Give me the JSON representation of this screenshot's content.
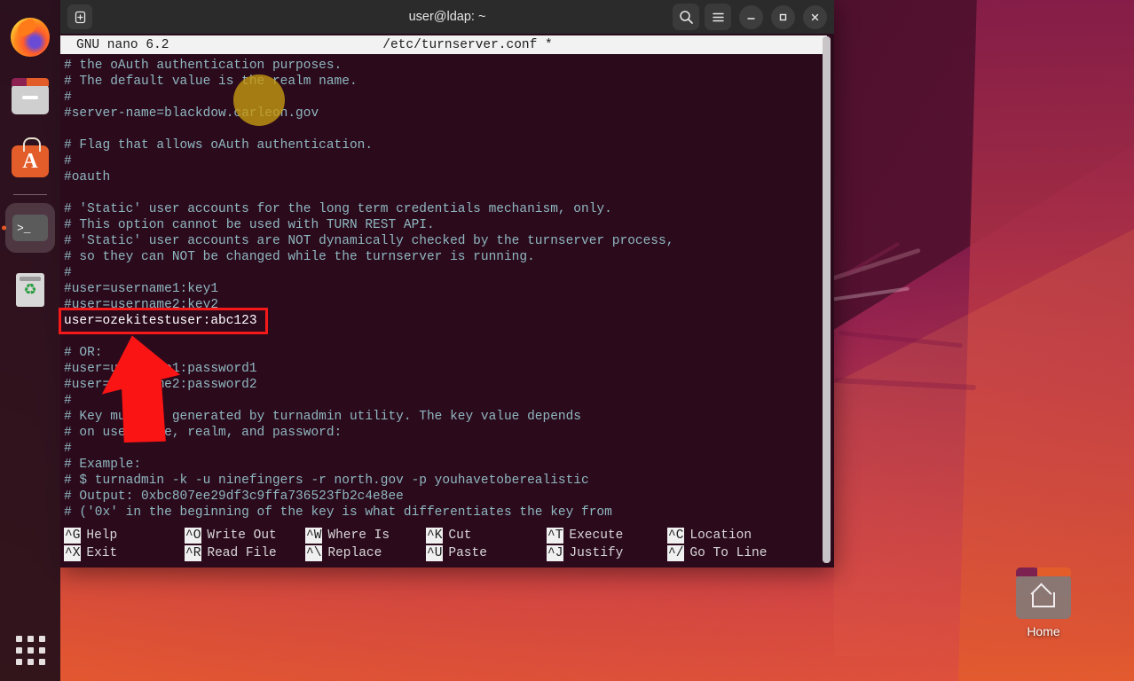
{
  "desktop": {
    "home_icon_label": "Home",
    "wallpaper_colors": [
      "#5d1236",
      "#912050",
      "#b92f52",
      "#e2572f"
    ]
  },
  "dock": {
    "items": [
      {
        "name": "firefox",
        "label": "Firefox",
        "active": false
      },
      {
        "name": "files",
        "label": "Files",
        "active": false
      },
      {
        "name": "ubuntu-software",
        "label": "Ubuntu Software",
        "letter": "A",
        "active": false
      },
      {
        "name": "terminal",
        "label": "Terminal",
        "glyph": ">_",
        "active": true
      },
      {
        "name": "trash",
        "label": "Trash",
        "glyph": "♻",
        "active": false
      }
    ],
    "show_apps_label": "Show Applications"
  },
  "window": {
    "title": "user@ldap: ~",
    "buttons": {
      "new_tab": "+",
      "search": "search-icon",
      "menu": "hamburger-menu-icon",
      "minimize": "–",
      "maximize": "□",
      "close": "✕"
    }
  },
  "editor": {
    "version": "GNU nano 6.2",
    "filename": "/etc/turnserver.conf *",
    "lines": [
      {
        "text": "# the oAuth authentication purposes.",
        "highlight": false
      },
      {
        "text": "# The default value is the realm name.",
        "highlight": false
      },
      {
        "text": "#",
        "highlight": false
      },
      {
        "text": "#server-name=blackdow.carleon.gov",
        "highlight": false
      },
      {
        "text": "",
        "highlight": false
      },
      {
        "text": "# Flag that allows oAuth authentication.",
        "highlight": false
      },
      {
        "text": "#",
        "highlight": false
      },
      {
        "text": "#oauth",
        "highlight": false
      },
      {
        "text": "",
        "highlight": false
      },
      {
        "text": "# 'Static' user accounts for the long term credentials mechanism, only.",
        "highlight": false
      },
      {
        "text": "# This option cannot be used with TURN REST API.",
        "highlight": false
      },
      {
        "text": "# 'Static' user accounts are NOT dynamically checked by the turnserver process,",
        "highlight": false
      },
      {
        "text": "# so they can NOT be changed while the turnserver is running.",
        "highlight": false
      },
      {
        "text": "#",
        "highlight": false
      },
      {
        "text": "#user=username1:key1",
        "highlight": false
      },
      {
        "text": "#user=username2:key2",
        "highlight": false
      },
      {
        "text": "user=ozekitestuser:abc123",
        "highlight": true
      },
      {
        "text": "",
        "highlight": false
      },
      {
        "text": "# OR:",
        "highlight": false
      },
      {
        "text": "#user=username1:password1",
        "highlight": false
      },
      {
        "text": "#user=username2:password2",
        "highlight": false
      },
      {
        "text": "#",
        "highlight": false
      },
      {
        "text": "# Key must be generated by turnadmin utility. The key value depends",
        "highlight": false
      },
      {
        "text": "# on user name, realm, and password:",
        "highlight": false
      },
      {
        "text": "#",
        "highlight": false
      },
      {
        "text": "# Example:",
        "highlight": false
      },
      {
        "text": "# $ turnadmin -k -u ninefingers -r north.gov -p youhavetoberealistic",
        "highlight": false
      },
      {
        "text": "# Output: 0xbc807ee29df3c9ffa736523fb2c4e8ee",
        "highlight": false
      },
      {
        "text": "# ('0x' in the beginning of the key is what differentiates the key from",
        "highlight": false
      }
    ],
    "shortcuts_row1": [
      {
        "key": "^G",
        "label": "Help"
      },
      {
        "key": "^O",
        "label": "Write Out"
      },
      {
        "key": "^W",
        "label": "Where Is"
      },
      {
        "key": "^K",
        "label": "Cut"
      },
      {
        "key": "^T",
        "label": "Execute"
      },
      {
        "key": "^C",
        "label": "Location"
      }
    ],
    "shortcuts_row2": [
      {
        "key": "^X",
        "label": "Exit"
      },
      {
        "key": "^R",
        "label": "Read File"
      },
      {
        "key": "^\\",
        "label": "Replace"
      },
      {
        "key": "^U",
        "label": "Paste"
      },
      {
        "key": "^J",
        "label": "Justify"
      },
      {
        "key": "^/",
        "label": "Go To Line"
      }
    ],
    "colors": {
      "background": "#2b0a1c",
      "comment_text": "#8fb8c0",
      "active_text": "#ffffff",
      "header_bg": "#f2f2f2"
    }
  },
  "annotations": {
    "highlight_box_color": "#f51919",
    "highlight_box_target": "user=ozekitestuser:abc123",
    "arrow_color": "#fb1414",
    "click_marker_color": "#c49812"
  }
}
